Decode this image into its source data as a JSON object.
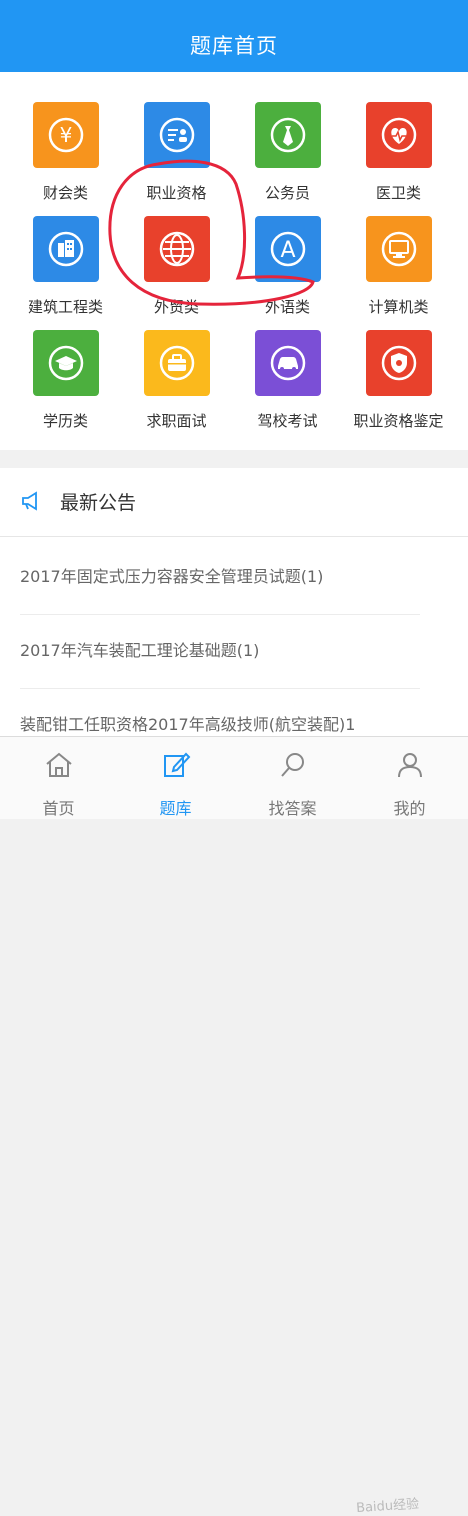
{
  "header": {
    "title": "题库首页"
  },
  "categories": [
    {
      "label": "财会类",
      "color": "#f7941d",
      "icon": "yen-icon"
    },
    {
      "label": "职业资格",
      "color": "#2d8ae6",
      "icon": "id-card-icon"
    },
    {
      "label": "公务员",
      "color": "#4caf3e",
      "icon": "necktie-icon"
    },
    {
      "label": "医卫类",
      "color": "#e8412c",
      "icon": "heart-icon"
    },
    {
      "label": "建筑工程类",
      "color": "#2d8ae6",
      "icon": "building-icon"
    },
    {
      "label": "外贸类",
      "color": "#e8412c",
      "icon": "globe-icon"
    },
    {
      "label": "外语类",
      "color": "#2d8ae6",
      "icon": "letter-a-icon"
    },
    {
      "label": "计算机类",
      "color": "#f7941d",
      "icon": "monitor-icon"
    },
    {
      "label": "学历类",
      "color": "#4caf3e",
      "icon": "graduation-cap-icon"
    },
    {
      "label": "求职面试",
      "color": "#fbb91c",
      "icon": "briefcase-icon"
    },
    {
      "label": "驾校考试",
      "color": "#7b4fd6",
      "icon": "car-icon"
    },
    {
      "label": "职业资格鉴定",
      "color": "#e8412c",
      "icon": "badge-icon"
    }
  ],
  "announcements": {
    "title": "最新公告",
    "items": [
      "2017年固定式压力容器安全管理员试题(1)",
      "2017年汽车装配工理论基础题(1)",
      "装配钳工任职资格2017年高级技师(航空装配)1"
    ]
  },
  "tabs": [
    {
      "label": "首页",
      "icon": "home-icon",
      "active": false
    },
    {
      "label": "题库",
      "icon": "edit-icon",
      "active": true
    },
    {
      "label": "找答案",
      "icon": "search-icon",
      "active": false
    },
    {
      "label": "我的",
      "icon": "user-icon",
      "active": false
    }
  ],
  "watermark": "Baidu经验",
  "colors": {
    "primary": "#2196f3",
    "annotation": "#e5243b"
  }
}
